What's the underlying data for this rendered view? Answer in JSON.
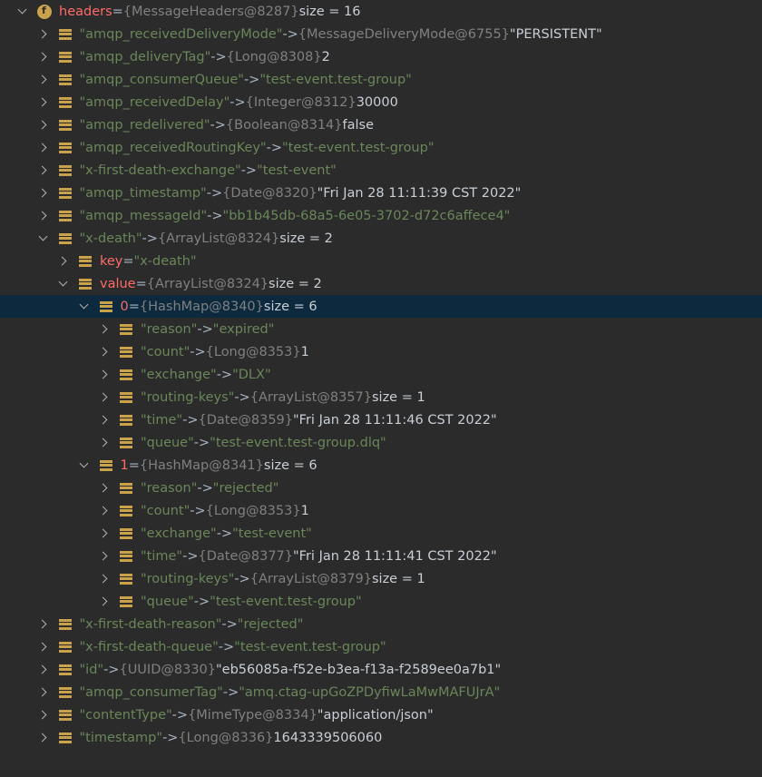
{
  "tree": {
    "rows": [
      {
        "arrow": "open",
        "icon": "root",
        "key": "headers",
        "kc": "kr",
        "sep": "=",
        "type": "{MessageHeaders@8287}",
        "val": "size = 16",
        "vc": "v"
      },
      {
        "arrow": "closed",
        "icon": "field",
        "key": "\"amqp_receivedDeliveryMode\"",
        "kc": "k",
        "sep": "->",
        "type": "{MessageDeliveryMode@6755}",
        "val": "\"PERSISTENT\"",
        "vc": "v"
      },
      {
        "arrow": "closed",
        "icon": "field",
        "key": "\"amqp_deliveryTag\"",
        "kc": "k",
        "sep": "->",
        "type": "{Long@8308}",
        "val": "2",
        "vc": "v"
      },
      {
        "arrow": "closed",
        "icon": "field",
        "key": "\"amqp_consumerQueue\"",
        "kc": "k",
        "sep": "->",
        "type": "",
        "val": "\"test-event.test-group\"",
        "vc": "s"
      },
      {
        "arrow": "closed",
        "icon": "field",
        "key": "\"amqp_receivedDelay\"",
        "kc": "k",
        "sep": "->",
        "type": "{Integer@8312}",
        "val": "30000",
        "vc": "v"
      },
      {
        "arrow": "closed",
        "icon": "field",
        "key": "\"amqp_redelivered\"",
        "kc": "k",
        "sep": "->",
        "type": "{Boolean@8314}",
        "val": "false",
        "vc": "v"
      },
      {
        "arrow": "closed",
        "icon": "field",
        "key": "\"amqp_receivedRoutingKey\"",
        "kc": "k",
        "sep": "->",
        "type": "",
        "val": "\"test-event.test-group\"",
        "vc": "s"
      },
      {
        "arrow": "closed",
        "icon": "field",
        "key": "\"x-first-death-exchange\"",
        "kc": "k",
        "sep": "->",
        "type": "",
        "val": "\"test-event\"",
        "vc": "s"
      },
      {
        "arrow": "closed",
        "icon": "field",
        "key": "\"amqp_timestamp\"",
        "kc": "k",
        "sep": "->",
        "type": "{Date@8320}",
        "val": "\"Fri Jan 28 11:11:39 CST 2022\"",
        "vc": "v"
      },
      {
        "arrow": "closed",
        "icon": "field",
        "key": "\"amqp_messageId\"",
        "kc": "k",
        "sep": "->",
        "type": "",
        "val": "\"bb1b45db-68a5-6e05-3702-d72c6affece4\"",
        "vc": "s"
      },
      {
        "arrow": "open",
        "icon": "field",
        "key": "\"x-death\"",
        "kc": "k",
        "sep": "->",
        "type": "{ArrayList@8324}",
        "val": "size = 2",
        "vc": "v"
      },
      {
        "arrow": "closed",
        "icon": "field",
        "key": "key",
        "kc": "kr",
        "sep": "=",
        "type": "",
        "val": "\"x-death\"",
        "vc": "s"
      },
      {
        "arrow": "open",
        "icon": "field",
        "key": "value",
        "kc": "kr",
        "sep": "=",
        "type": "{ArrayList@8324}",
        "val": "size = 2",
        "vc": "v"
      },
      {
        "arrow": "open",
        "icon": "field",
        "key": "0",
        "kc": "kr",
        "sep": "=",
        "type": "{HashMap@8340}",
        "val": "size = 6",
        "vc": "v",
        "selected": true
      },
      {
        "arrow": "closed",
        "icon": "field",
        "key": "\"reason\"",
        "kc": "k",
        "sep": "->",
        "type": "",
        "val": "\"expired\"",
        "vc": "s"
      },
      {
        "arrow": "closed",
        "icon": "field",
        "key": "\"count\"",
        "kc": "k",
        "sep": "->",
        "type": "{Long@8353}",
        "val": "1",
        "vc": "v"
      },
      {
        "arrow": "closed",
        "icon": "field",
        "key": "\"exchange\"",
        "kc": "k",
        "sep": "->",
        "type": "",
        "val": "\"DLX\"",
        "vc": "s"
      },
      {
        "arrow": "closed",
        "icon": "field",
        "key": "\"routing-keys\"",
        "kc": "k",
        "sep": "->",
        "type": "{ArrayList@8357}",
        "val": "size = 1",
        "vc": "v"
      },
      {
        "arrow": "closed",
        "icon": "field",
        "key": "\"time\"",
        "kc": "k",
        "sep": "->",
        "type": "{Date@8359}",
        "val": "\"Fri Jan 28 11:11:46 CST 2022\"",
        "vc": "v"
      },
      {
        "arrow": "closed",
        "icon": "field",
        "key": "\"queue\"",
        "kc": "k",
        "sep": "->",
        "type": "",
        "val": "\"test-event.test-group.dlq\"",
        "vc": "s"
      },
      {
        "arrow": "open",
        "icon": "field",
        "key": "1",
        "kc": "kr",
        "sep": "=",
        "type": "{HashMap@8341}",
        "val": "size = 6",
        "vc": "v"
      },
      {
        "arrow": "closed",
        "icon": "field",
        "key": "\"reason\"",
        "kc": "k",
        "sep": "->",
        "type": "",
        "val": "\"rejected\"",
        "vc": "s"
      },
      {
        "arrow": "closed",
        "icon": "field",
        "key": "\"count\"",
        "kc": "k",
        "sep": "->",
        "type": "{Long@8353}",
        "val": "1",
        "vc": "v"
      },
      {
        "arrow": "closed",
        "icon": "field",
        "key": "\"exchange\"",
        "kc": "k",
        "sep": "->",
        "type": "",
        "val": "\"test-event\"",
        "vc": "s"
      },
      {
        "arrow": "closed",
        "icon": "field",
        "key": "\"time\"",
        "kc": "k",
        "sep": "->",
        "type": "{Date@8377}",
        "val": "\"Fri Jan 28 11:11:41 CST 2022\"",
        "vc": "v"
      },
      {
        "arrow": "closed",
        "icon": "field",
        "key": "\"routing-keys\"",
        "kc": "k",
        "sep": "->",
        "type": "{ArrayList@8379}",
        "val": "size = 1",
        "vc": "v"
      },
      {
        "arrow": "closed",
        "icon": "field",
        "key": "\"queue\"",
        "kc": "k",
        "sep": "->",
        "type": "",
        "val": "\"test-event.test-group\"",
        "vc": "s"
      },
      {
        "arrow": "closed",
        "icon": "field",
        "key": "\"x-first-death-reason\"",
        "kc": "k",
        "sep": "->",
        "type": "",
        "val": "\"rejected\"",
        "vc": "s"
      },
      {
        "arrow": "closed",
        "icon": "field",
        "key": "\"x-first-death-queue\"",
        "kc": "k",
        "sep": "->",
        "type": "",
        "val": "\"test-event.test-group\"",
        "vc": "s"
      },
      {
        "arrow": "closed",
        "icon": "field",
        "key": "\"id\"",
        "kc": "k",
        "sep": "->",
        "type": "{UUID@8330}",
        "val": "\"eb56085a-f52e-b3ea-f13a-f2589ee0a7b1\"",
        "vc": "v"
      },
      {
        "arrow": "closed",
        "icon": "field",
        "key": "\"amqp_consumerTag\"",
        "kc": "k",
        "sep": "->",
        "type": "",
        "val": "\"amq.ctag-upGoZPDyfiwLaMwMAFUJrA\"",
        "vc": "s"
      },
      {
        "arrow": "closed",
        "icon": "field",
        "key": "\"contentType\"",
        "kc": "k",
        "sep": "->",
        "type": "{MimeType@8334}",
        "val": "\"application/json\"",
        "vc": "v"
      },
      {
        "arrow": "closed",
        "icon": "field",
        "key": "\"timestamp\"",
        "kc": "k",
        "sep": "->",
        "type": "{Long@8336}",
        "val": "1643339506060",
        "vc": "v"
      }
    ]
  }
}
